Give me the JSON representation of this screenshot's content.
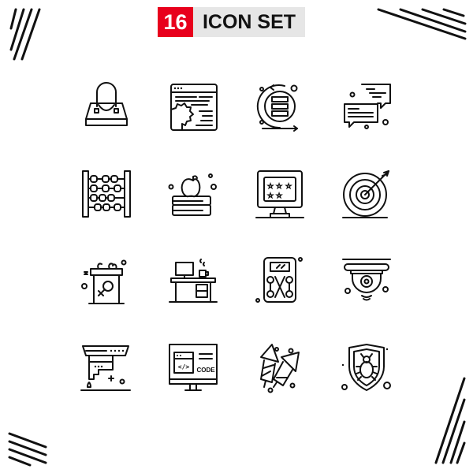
{
  "header": {
    "count": "16",
    "title": "ICON SET",
    "badge_color": "#e8001c",
    "title_bg_color": "#e6e6e6"
  },
  "icons": [
    {
      "name": "handbag-icon",
      "label": "handbag"
    },
    {
      "name": "web-settings-icon",
      "label": "browser window with gear"
    },
    {
      "name": "server-sync-icon",
      "label": "server with refresh arrows"
    },
    {
      "name": "chat-bubbles-icon",
      "label": "chat messages"
    },
    {
      "name": "abacus-icon",
      "label": "abacus"
    },
    {
      "name": "books-apple-icon",
      "label": "books with apple"
    },
    {
      "name": "monitor-rating-icon",
      "label": "monitor with stars"
    },
    {
      "name": "target-icon",
      "label": "target with arrow"
    },
    {
      "name": "podium-female-icon",
      "label": "podium with female symbol"
    },
    {
      "name": "office-desk-icon",
      "label": "desk with computer and mug"
    },
    {
      "name": "circuit-board-icon",
      "label": "electronic device board"
    },
    {
      "name": "security-camera-icon",
      "label": "dome cctv camera"
    },
    {
      "name": "kitchen-hood-icon",
      "label": "cooker hood"
    },
    {
      "name": "code-monitor-icon",
      "label": "monitor with code",
      "text": "CODE",
      "glyph": "</>"
    },
    {
      "name": "fireworks-icon",
      "label": "firework rockets"
    },
    {
      "name": "bug-shield-icon",
      "label": "shield with bug"
    }
  ]
}
